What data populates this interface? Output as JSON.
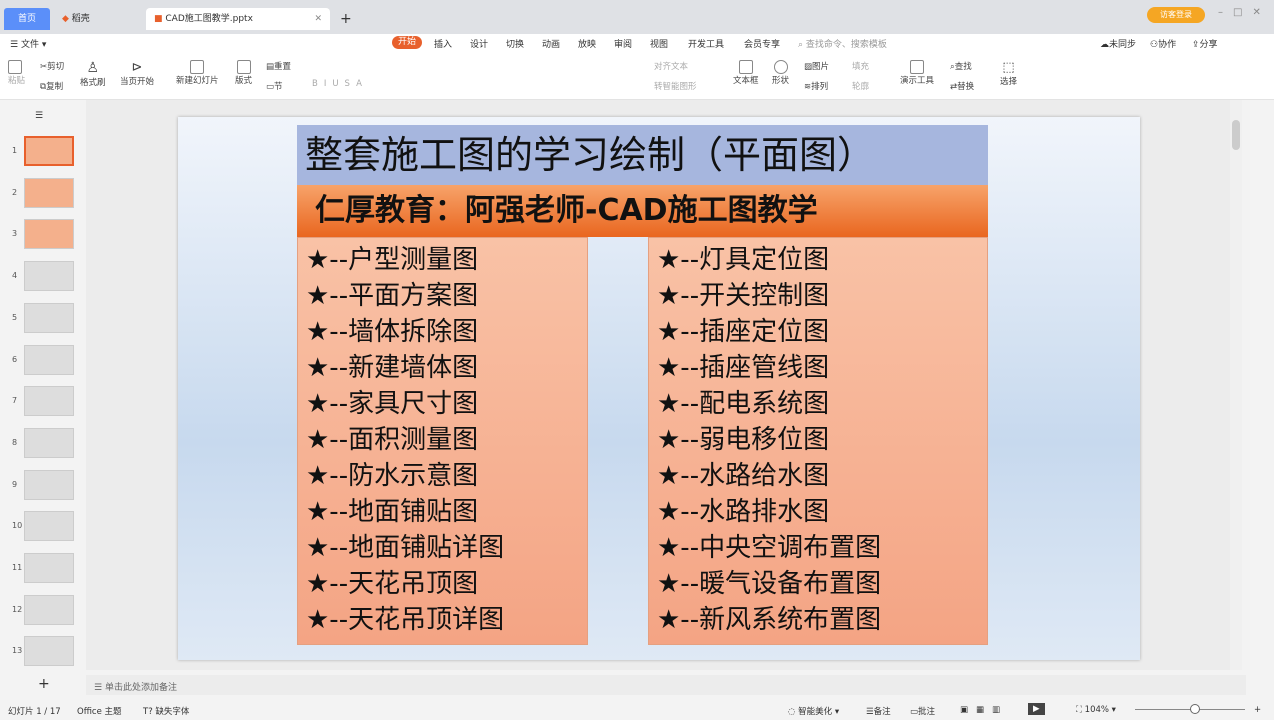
{
  "tabs": {
    "home": "首页",
    "straw": "稻壳",
    "doc": "CAD施工图教学.pptx",
    "login": "访客登录"
  },
  "menu": {
    "file": "文件",
    "items": [
      "开始",
      "插入",
      "设计",
      "切换",
      "动画",
      "放映",
      "审阅",
      "视图",
      "开发工具",
      "会员专享"
    ],
    "search_placeholder": "查找命令、搜索模板",
    "sync": "未同步",
    "collab": "协作",
    "share": "分享"
  },
  "ribbon": {
    "paste": "粘贴",
    "cut": "剪切",
    "copy": "复制",
    "format_painter": "格式刷",
    "from_current": "当页开始",
    "new_slide": "新建幻灯片",
    "layout": "版式",
    "reset": "重置",
    "section": "节",
    "align_text": "对齐文本",
    "smartart": "转智能图形",
    "textbox": "文本框",
    "shape": "形状",
    "picture": "图片",
    "fill": "填充",
    "arrange": "排列",
    "outline": "轮廓",
    "present_tools": "演示工具",
    "find": "查找",
    "replace": "替换",
    "select": "选择"
  },
  "slides": {
    "count": 13,
    "numbers": [
      "1",
      "2",
      "3",
      "4",
      "5",
      "6",
      "7",
      "8",
      "9",
      "10",
      "11",
      "12",
      "13"
    ]
  },
  "slide": {
    "title": "整套施工图的学习绘制（平面图）",
    "subtitle": "仁厚教育：阿强老师-CAD施工图教学",
    "left": [
      "★--户型测量图",
      "★--平面方案图",
      "★--墙体拆除图",
      "★--新建墙体图",
      "★--家具尺寸图",
      "★--面积测量图",
      "★--防水示意图",
      "★--地面铺贴图",
      "★--地面铺贴详图",
      "★--天花吊顶图",
      "★--天花吊顶详图"
    ],
    "right": [
      "★--灯具定位图",
      "★--开关控制图",
      "★--插座定位图",
      "★--插座管线图",
      "★--配电系统图",
      "★--弱电移位图",
      "★--水路给水图",
      "★--水路排水图",
      "★--中央空调布置图",
      "★--暖气设备布置图",
      "★--新风系统布置图"
    ]
  },
  "notes": {
    "placeholder": "单击此处添加备注"
  },
  "status": {
    "slide": "幻灯片 1 / 17",
    "theme": "Office 主题",
    "font": "缺失字体",
    "beautify": "智能美化",
    "notes": "备注",
    "comment": "批注",
    "zoom": "104%"
  },
  "colors": {
    "accent": "#e8602c",
    "home_tab": "#5b8ff9",
    "title_bg": "#a6b6de",
    "subtitle_bg": "#e9661f",
    "column_bg": "#f6b396"
  }
}
